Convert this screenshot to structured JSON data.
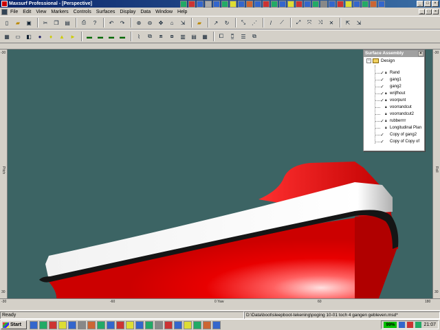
{
  "window": {
    "title": "Maxsurf Professional - [Perspective]",
    "controls": [
      "_",
      "□",
      "×"
    ]
  },
  "menu": {
    "items": [
      "File",
      "Edit",
      "View",
      "Markers",
      "Controls",
      "Surfaces",
      "Display",
      "Data",
      "Window",
      "Help"
    ]
  },
  "toolbar1": {
    "icons": [
      "new-icon",
      "open-icon",
      "save-icon",
      "cut-icon",
      "copy-icon",
      "paste-icon",
      "print-icon",
      "help-icon",
      "undo-icon",
      "redo-icon",
      "zoom-in-icon",
      "zoom-out-icon",
      "pan-icon",
      "home-icon",
      "shrink-icon",
      "measure-icon",
      "select-icon",
      "rotate-icon",
      "control-point-icon",
      "add-point-icon",
      "delete-point-icon",
      "edge-icon",
      "bond-icon",
      "move-icon",
      "align-icon",
      "tool-icon"
    ]
  },
  "toolbar2": {
    "icons": [
      "grid-icon",
      "frame-icon",
      "render-icon",
      "sphere-icon",
      "light-icon",
      "color-icon",
      "dim-icon",
      "surface-1-icon",
      "surface-2-icon",
      "surface-3-icon",
      "surface-4-icon",
      "curves-icon",
      "sections-icon",
      "buttocks-icon",
      "waterlines-icon",
      "diagonals-icon",
      "lines-icon",
      "table-icon",
      "markers-icon",
      "view-icon",
      "list-icon"
    ]
  },
  "viewport": {
    "background_color": "#3c6464",
    "ruler_labels": {
      "top_left": "-30",
      "bottom_left": "-30",
      "bottom_left2": "-60",
      "bottom_center": "0 Yaw",
      "bottom_right": "60",
      "bottom_right2": "180",
      "left_center": "Pitch",
      "right_center": "Roll",
      "left_bottom": "30",
      "right_bottom": "30",
      "right_top": "-30"
    }
  },
  "surface_panel": {
    "title": "Surface Assembly",
    "root": "Design",
    "items": [
      {
        "name": "Rand",
        "checked": true,
        "locked": true
      },
      {
        "name": "gang1",
        "checked": true,
        "locked": false
      },
      {
        "name": "gang2",
        "checked": true,
        "locked": false
      },
      {
        "name": "wrijfhout",
        "checked": true,
        "locked": true
      },
      {
        "name": "voorpunt",
        "checked": true,
        "locked": true
      },
      {
        "name": "voorrandcut",
        "checked": false,
        "locked": true
      },
      {
        "name": "voorrandcut2",
        "checked": false,
        "locked": true
      },
      {
        "name": "rubberrrr",
        "checked": true,
        "locked": true
      },
      {
        "name": "Longitudinal Plan",
        "checked": false,
        "locked": true
      },
      {
        "name": "Copy of gang2",
        "checked": true,
        "locked": false
      },
      {
        "name": "Copy of Copy of",
        "checked": true,
        "locked": false
      }
    ]
  },
  "statusbar": {
    "status": "Ready",
    "path": "D:\\Data\\boot\\sleepboot-tekening\\poging 10-01 toch 4 gangen gebleven.msd*"
  },
  "taskbar": {
    "start_label": "Start",
    "battery": "99%",
    "clock": "21:07"
  },
  "colors": {
    "hull_red": "#e80000",
    "stripe_white": "#f4f4f4",
    "rubbing_strake": "#151515",
    "titlebar": "#0a246a"
  }
}
